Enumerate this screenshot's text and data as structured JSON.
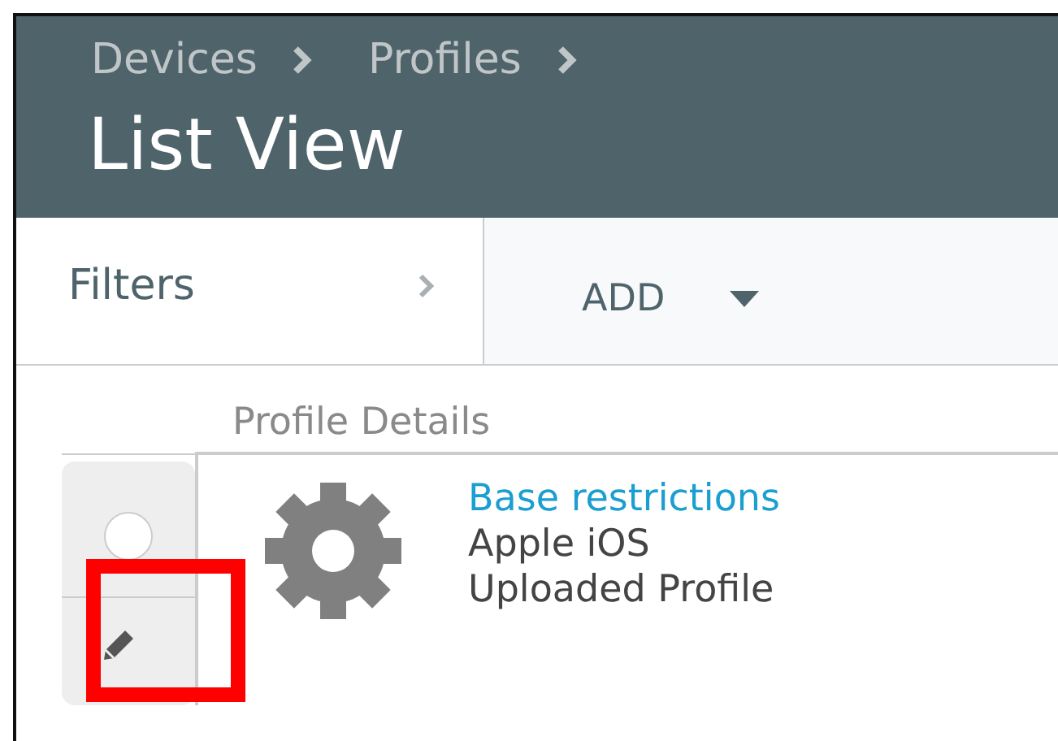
{
  "breadcrumb": [
    {
      "label": "Devices"
    },
    {
      "label": "Profiles"
    }
  ],
  "title": "List View",
  "toolbar": {
    "filters": "Filters",
    "add": "ADD"
  },
  "table": {
    "column_header": "Profile Details",
    "rows": [
      {
        "selected": false,
        "name": "Base restrictions",
        "platform": "Apple iOS",
        "type": "Uploaded Profile"
      }
    ]
  }
}
